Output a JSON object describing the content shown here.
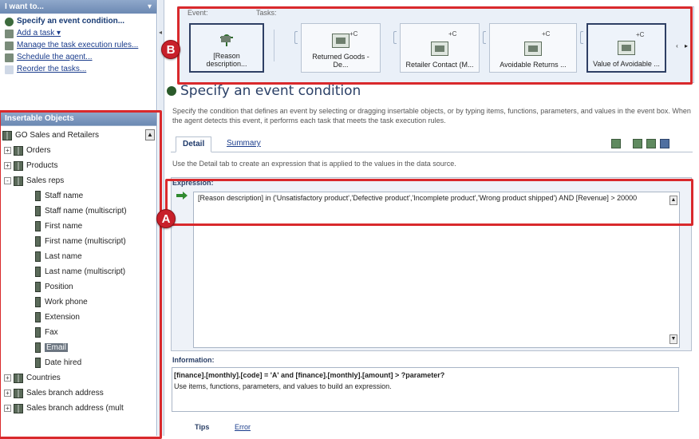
{
  "left_panel": {
    "header": "I want to...",
    "tasks": [
      {
        "label": "Specify an event condition...",
        "bold": true,
        "link": false
      },
      {
        "label": "Add a task ▾",
        "bold": false,
        "link": true
      },
      {
        "label": "Manage the task execution rules...",
        "bold": false,
        "link": true
      },
      {
        "label": "Schedule the agent...",
        "bold": false,
        "link": true
      },
      {
        "label": "Reorder the tasks...",
        "bold": false,
        "link": true
      }
    ],
    "objects_header": "Insertable Objects",
    "tree": [
      {
        "label": "GO Sales and Retailers",
        "level": 0,
        "toggle": "",
        "type": "package"
      },
      {
        "label": "Orders",
        "level": 1,
        "toggle": "+",
        "type": "folder"
      },
      {
        "label": "Products",
        "level": 1,
        "toggle": "+",
        "type": "folder"
      },
      {
        "label": "Sales reps",
        "level": 1,
        "toggle": "-",
        "type": "folder"
      },
      {
        "label": "Staff name",
        "level": 2,
        "toggle": "",
        "type": "item"
      },
      {
        "label": "Staff name (multiscript)",
        "level": 2,
        "toggle": "",
        "type": "item"
      },
      {
        "label": "First name",
        "level": 2,
        "toggle": "",
        "type": "item"
      },
      {
        "label": "First name (multiscript)",
        "level": 2,
        "toggle": "",
        "type": "item"
      },
      {
        "label": "Last name",
        "level": 2,
        "toggle": "",
        "type": "item"
      },
      {
        "label": "Last name (multiscript)",
        "level": 2,
        "toggle": "",
        "type": "item"
      },
      {
        "label": "Position",
        "level": 2,
        "toggle": "",
        "type": "item"
      },
      {
        "label": "Work phone",
        "level": 2,
        "toggle": "",
        "type": "item"
      },
      {
        "label": "Extension",
        "level": 2,
        "toggle": "",
        "type": "item"
      },
      {
        "label": "Fax",
        "level": 2,
        "toggle": "",
        "type": "item"
      },
      {
        "label": "Email",
        "level": 2,
        "toggle": "",
        "type": "item",
        "selected": true
      },
      {
        "label": "Date hired",
        "level": 2,
        "toggle": "",
        "type": "item"
      },
      {
        "label": "Countries",
        "level": 1,
        "toggle": "+",
        "type": "folder"
      },
      {
        "label": "Sales branch address",
        "level": 1,
        "toggle": "+",
        "type": "folder"
      },
      {
        "label": "Sales branch address (mult",
        "level": 1,
        "toggle": "+",
        "type": "folder"
      }
    ]
  },
  "ribbon": {
    "event_label": "Event:",
    "tasks_label": "Tasks:",
    "cards": [
      {
        "label": "[Reason description...",
        "selected": true,
        "badge": ""
      },
      {
        "label": "Returned Goods - De...",
        "selected": false,
        "badge": "+C"
      },
      {
        "label": "Retailer Contact (M...",
        "selected": false,
        "badge": "+C"
      },
      {
        "label": "Avoidable Returns ...",
        "selected": false,
        "badge": "+C"
      },
      {
        "label": "Value of Avoidable ...",
        "selected": true,
        "badge": "+C"
      }
    ],
    "nav": "‹ ▸"
  },
  "callouts": {
    "a": "A",
    "b": "B"
  },
  "main": {
    "title": "Specify an event condition",
    "description": "Specify the condition that defines an event by selecting or dragging insertable objects, or by typing items, functions, parameters, and values in the event box. When the agent detects this event, it performs each task that meets the task execution rules.",
    "tabs": {
      "detail": "Detail",
      "summary": "Summary"
    },
    "tab_note": "Use the Detail tab to create an expression that is applied to the values in the data source.",
    "expression_label": "Expression:",
    "expression": "[Reason description] in ('Unsatisfactory product','Defective product','Incomplete product','Wrong product shipped') AND [Revenue] > 20000",
    "information_label": "Information:",
    "info_line1": "[finance].[monthly].[code] = 'A' and [finance].[monthly].[amount] > ?parameter?",
    "info_line2": "Use items, functions, parameters, and values to build an expression.",
    "bottom_tabs": {
      "tips": "Tips",
      "error": "Error"
    }
  },
  "colors": {
    "callout": "#d9292c",
    "header": "#6c89b3",
    "accent": "#2a3f66"
  }
}
